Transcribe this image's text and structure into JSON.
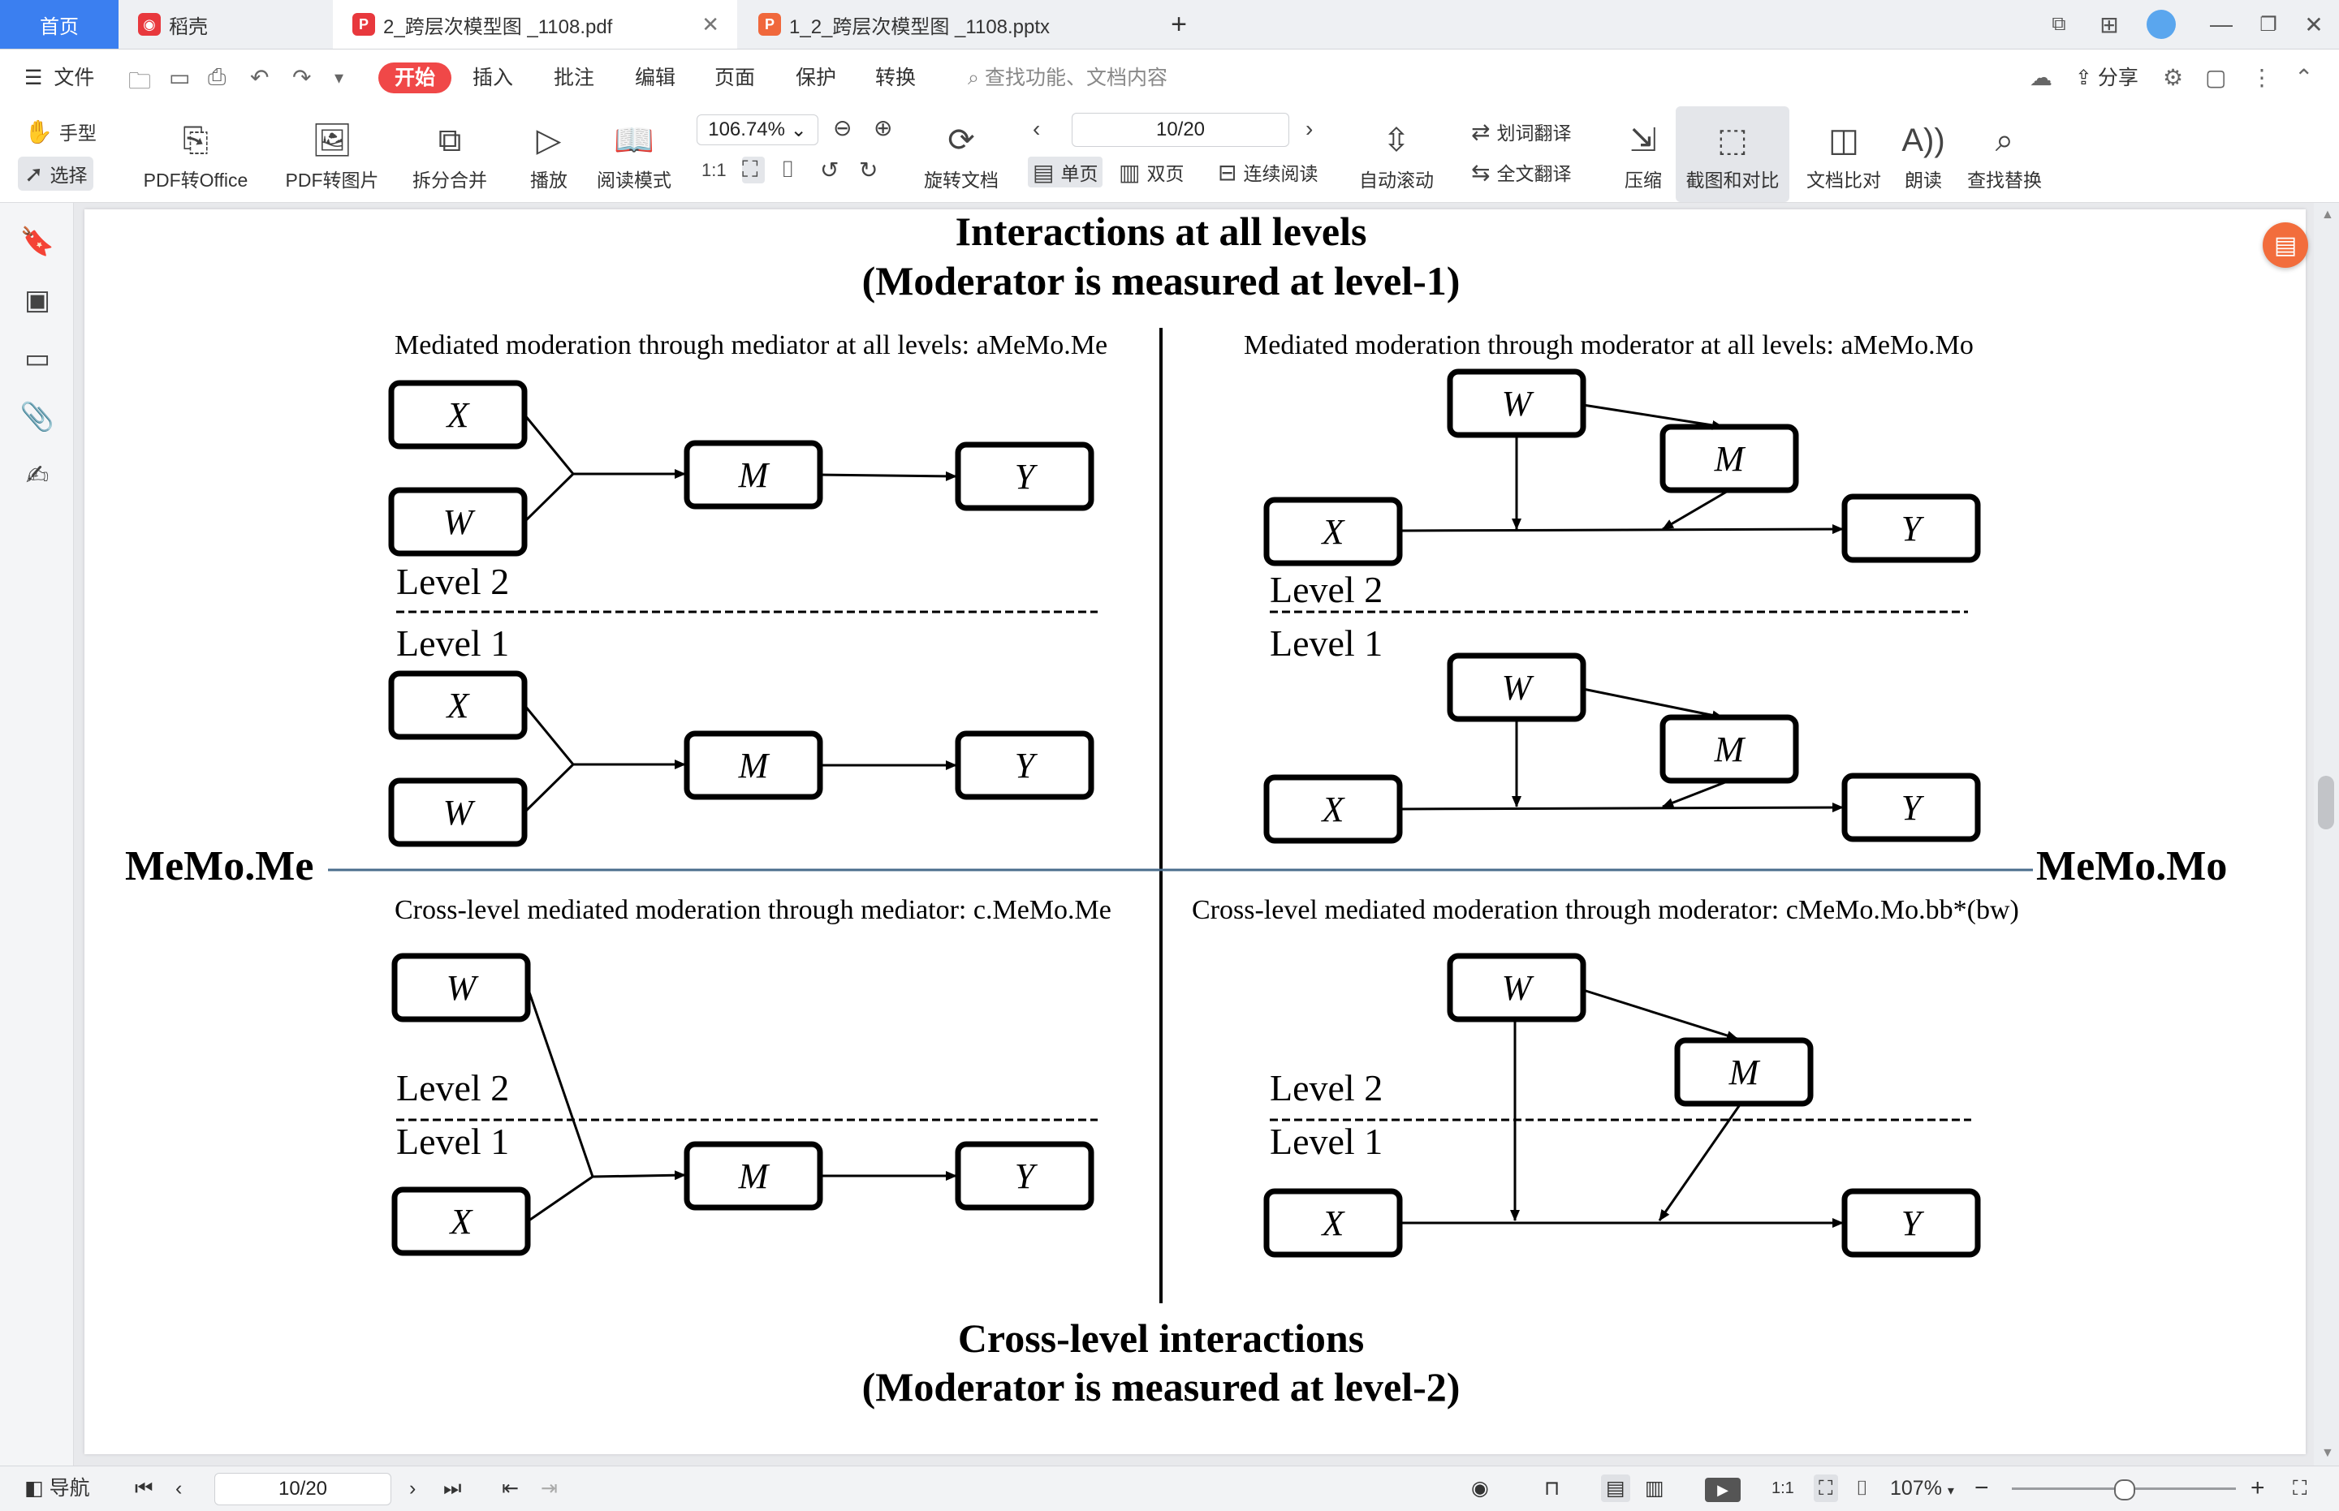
{
  "tabs": {
    "home": "首页",
    "daoke": "稻壳",
    "pdf": "2_跨层次模型图 _1108.pdf",
    "pptx": "1_2_跨层次模型图 _1108.pptx",
    "add": "+"
  },
  "menu": {
    "file": "文件",
    "start": "开始",
    "insert": "插入",
    "annotate": "批注",
    "edit": "编辑",
    "page": "页面",
    "protect": "保护",
    "convert": "转换",
    "search_placeholder": "查找功能、文档内容",
    "share": "分享"
  },
  "toolbar": {
    "hand": "手型",
    "select": "选择",
    "pdf_to_office": "PDF转Office",
    "pdf_to_image": "PDF转图片",
    "split_merge": "拆分合并",
    "play": "播放",
    "read_mode": "阅读模式",
    "zoom": "106.74%",
    "rotate": "旋转文档",
    "page_field": "10/20",
    "single": "单页",
    "double": "双页",
    "continuous": "连续阅读",
    "auto_scroll": "自动滚动",
    "word_translate": "划词翻译",
    "full_translate": "全文翻译",
    "compress": "压缩",
    "screenshot_compare": "截图和对比",
    "doc_compare": "文档比对",
    "read_aloud": "朗读",
    "find_replace": "查找替换"
  },
  "figure": {
    "title_top_1": "Interactions at all levels",
    "title_top_2": "(Moderator is measured at level-1)",
    "title_bottom_1": "Cross-level interactions",
    "title_bottom_2": "(Moderator is measured at level-2)",
    "side_left": "MeMo.Me",
    "side_right": "MeMo.Mo",
    "q1_title": "Mediated moderation through mediator at all levels: aMeMo.Me",
    "q2_title": "Mediated moderation through moderator at all levels: aMeMo.Mo",
    "q3_title": "Cross-level mediated moderation through mediator: c.MeMo.Me",
    "q4_title": "Cross-level mediated moderation through moderator: cMeMo.Mo.bb*(bw)",
    "level2": "Level 2",
    "level1": "Level 1",
    "node_x": "X",
    "node_w": "W",
    "node_m": "M",
    "node_y": "Y"
  },
  "status": {
    "nav": "导航",
    "page_field": "10/20",
    "zoom": "107%"
  },
  "colors": {
    "accent_blue": "#3b7ff0",
    "start_red": "#f04848",
    "float_orange": "#f26d3c",
    "divider_blue": "#4a6d8c"
  }
}
